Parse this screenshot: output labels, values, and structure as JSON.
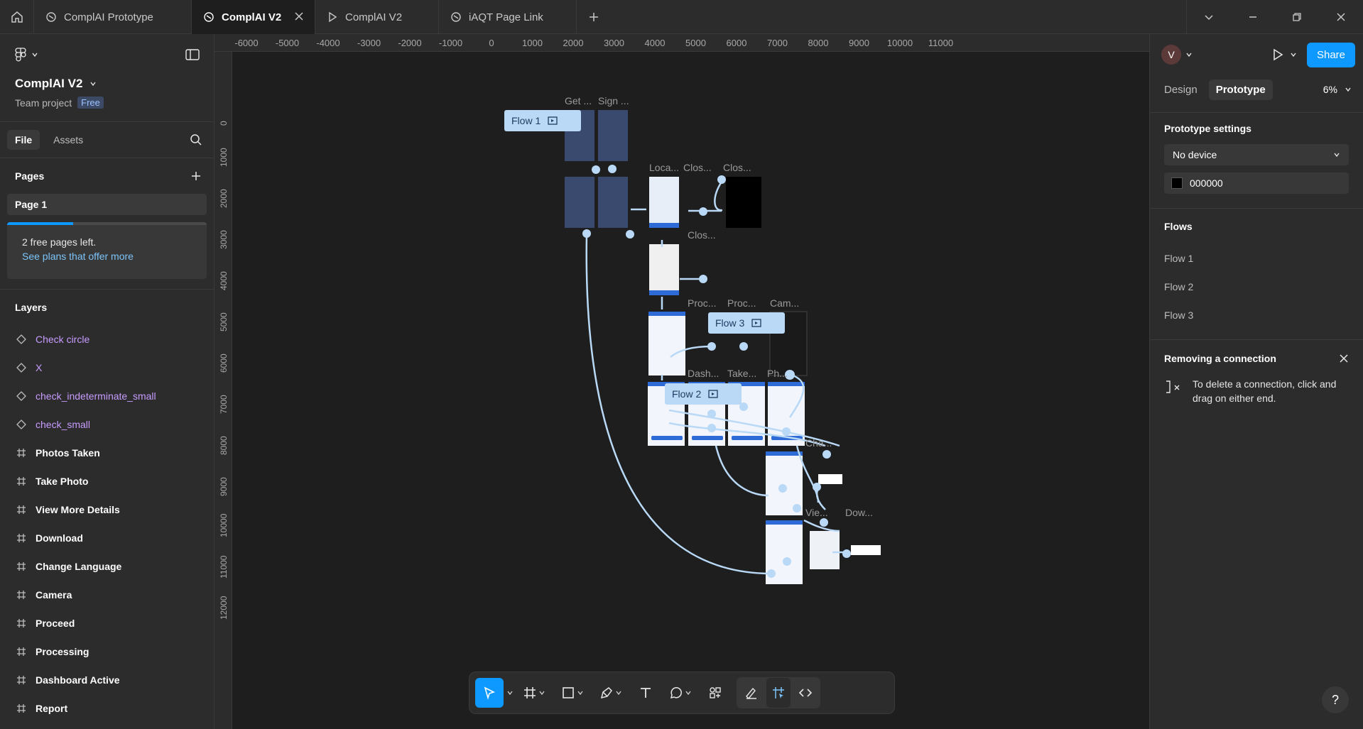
{
  "tabs": [
    {
      "label": "ComplAI Prototype",
      "icon": "figma-file-icon"
    },
    {
      "label": "ComplAI V2",
      "icon": "figma-file-icon",
      "active": true
    },
    {
      "label": "ComplAI V2",
      "icon": "play-prototype-icon"
    },
    {
      "label": "iAQT Page Link",
      "icon": "figma-file-icon"
    }
  ],
  "project": {
    "title": "ComplAI V2",
    "subtitle": "Team project",
    "plan_badge": "Free"
  },
  "left_tabs": {
    "file": "File",
    "assets": "Assets"
  },
  "pages": {
    "title": "Pages",
    "items": [
      "Page 1"
    ],
    "upsell_line1": "2 free pages left.",
    "upsell_link": "See plans that offer more",
    "usage_fraction": 0.33
  },
  "layers": {
    "title": "Layers",
    "items": [
      {
        "label": "Check circle",
        "kind": "component"
      },
      {
        "label": "X",
        "kind": "component"
      },
      {
        "label": "check_indeterminate_small",
        "kind": "component"
      },
      {
        "label": "check_small",
        "kind": "component"
      },
      {
        "label": "Photos Taken",
        "kind": "frame"
      },
      {
        "label": "Take Photo",
        "kind": "frame"
      },
      {
        "label": "View More Details",
        "kind": "frame"
      },
      {
        "label": "Download",
        "kind": "frame"
      },
      {
        "label": "Change Language",
        "kind": "frame"
      },
      {
        "label": "Camera",
        "kind": "frame"
      },
      {
        "label": "Proceed",
        "kind": "frame"
      },
      {
        "label": "Processing",
        "kind": "frame"
      },
      {
        "label": "Dashboard Active",
        "kind": "frame"
      },
      {
        "label": "Report",
        "kind": "frame"
      }
    ]
  },
  "ruler": {
    "x_ticks": [
      "-6000",
      "-5000",
      "-4000",
      "-3000",
      "-2000",
      "-1000",
      "0",
      "1000",
      "2000",
      "3000",
      "4000",
      "5000",
      "6000",
      "7000",
      "8000",
      "9000",
      "10000",
      "11000"
    ],
    "y_ticks": [
      "0",
      "1000",
      "2000",
      "3000",
      "4000",
      "5000",
      "6000",
      "7000",
      "8000",
      "9000",
      "10000",
      "11000",
      "12000"
    ]
  },
  "canvas": {
    "flows": [
      "Flow 1",
      "Flow 2",
      "Flow 3"
    ],
    "frame_labels": [
      "Get ...",
      "Sign ...",
      "Loca...",
      "Clos...",
      "Clos...",
      "Clos...",
      "Proc...",
      "Proc...",
      "Cam...",
      "Dash...",
      "Take...",
      "Ph...",
      "Cha...",
      "Vie...",
      "Dow..."
    ],
    "frame_fill": "#f2f6fc",
    "accent_blue": "#2e6bd6",
    "connector_color": "#b9d9f7"
  },
  "right_panel": {
    "avatar_letter": "V",
    "share_label": "Share",
    "tab_design": "Design",
    "tab_prototype": "Prototype",
    "zoom": "6%",
    "settings_title": "Prototype settings",
    "device_value": "No device",
    "background_hex": "000000",
    "flows_title": "Flows",
    "flows": [
      "Flow 1",
      "Flow 2",
      "Flow 3"
    ],
    "removing_title": "Removing a connection",
    "removing_text": "To delete a connection, click and drag on either end."
  },
  "help_label": "?"
}
